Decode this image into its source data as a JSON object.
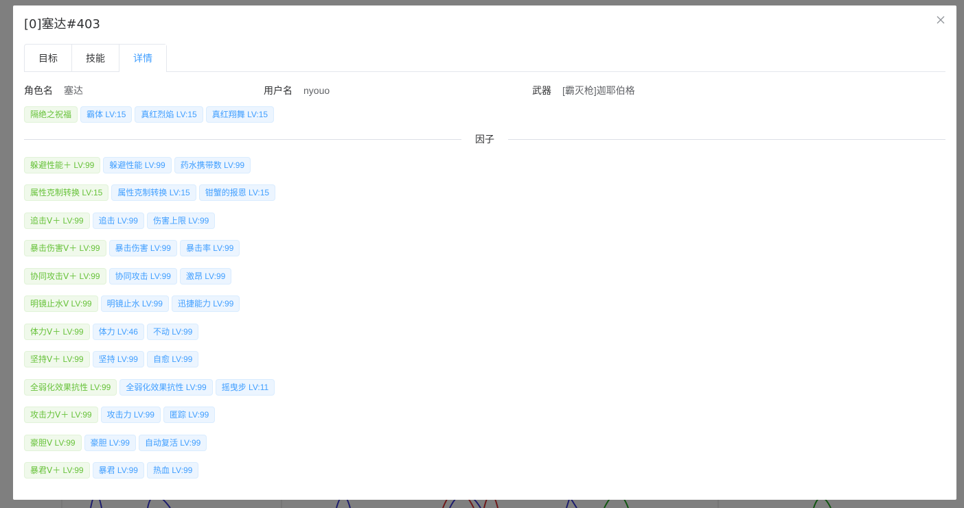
{
  "dialog": {
    "title": "[0]塞达#403",
    "close_icon": "close-icon"
  },
  "tabs": [
    {
      "label": "目标",
      "active": false
    },
    {
      "label": "技能",
      "active": false
    },
    {
      "label": "详情",
      "active": true
    }
  ],
  "info": {
    "role_label": "角色名",
    "role_value": "塞达",
    "user_label": "用户名",
    "user_value": "nyouo",
    "weapon_label": "武器",
    "weapon_value": "[霸灭枪]迦耶伯格"
  },
  "skills": [
    {
      "text": "隔绝之祝福",
      "color": "green"
    },
    {
      "text": "霸体 LV:15",
      "color": "blue"
    },
    {
      "text": "真红烈焰 LV:15",
      "color": "blue"
    },
    {
      "text": "真红翔舞 LV:15",
      "color": "blue"
    }
  ],
  "factor_title": "因子",
  "factors": [
    [
      {
        "text": "躲避性能＋ LV:99",
        "color": "green"
      },
      {
        "text": "躲避性能 LV:99",
        "color": "blue"
      },
      {
        "text": "药水携带数 LV:99",
        "color": "blue"
      }
    ],
    [
      {
        "text": "属性克制转换 LV:15",
        "color": "green"
      },
      {
        "text": "属性克制转换 LV:15",
        "color": "blue"
      },
      {
        "text": "钳蟹的报恩 LV:15",
        "color": "blue"
      }
    ],
    [
      {
        "text": "追击Ⅴ＋ LV:99",
        "color": "green"
      },
      {
        "text": "追击 LV:99",
        "color": "blue"
      },
      {
        "text": "伤害上限 LV:99",
        "color": "blue"
      }
    ],
    [
      {
        "text": "暴击伤害Ⅴ＋ LV:99",
        "color": "green"
      },
      {
        "text": "暴击伤害 LV:99",
        "color": "blue"
      },
      {
        "text": "暴击率 LV:99",
        "color": "blue"
      }
    ],
    [
      {
        "text": "协同攻击Ⅴ＋ LV:99",
        "color": "green"
      },
      {
        "text": "协同攻击 LV:99",
        "color": "blue"
      },
      {
        "text": "激昂 LV:99",
        "color": "blue"
      }
    ],
    [
      {
        "text": "明镜止水Ⅴ LV:99",
        "color": "green"
      },
      {
        "text": "明镜止水 LV:99",
        "color": "blue"
      },
      {
        "text": "迅捷能力 LV:99",
        "color": "blue"
      }
    ],
    [
      {
        "text": "体力Ⅴ＋ LV:99",
        "color": "green"
      },
      {
        "text": "体力 LV:46",
        "color": "blue"
      },
      {
        "text": "不动 LV:99",
        "color": "blue"
      }
    ],
    [
      {
        "text": "坚持Ⅴ＋ LV:99",
        "color": "green"
      },
      {
        "text": "坚持 LV:99",
        "color": "blue"
      },
      {
        "text": "自愈 LV:99",
        "color": "blue"
      }
    ],
    [
      {
        "text": "全弱化效果抗性 LV:99",
        "color": "green"
      },
      {
        "text": "全弱化效果抗性 LV:99",
        "color": "blue"
      },
      {
        "text": "摇曳步 LV:11",
        "color": "blue"
      }
    ],
    [
      {
        "text": "攻击力Ⅴ＋ LV:99",
        "color": "green"
      },
      {
        "text": "攻击力 LV:99",
        "color": "blue"
      },
      {
        "text": "匿踪 LV:99",
        "color": "blue"
      }
    ],
    [
      {
        "text": "豪胆Ⅴ LV:99",
        "color": "green"
      },
      {
        "text": "豪胆 LV:99",
        "color": "blue"
      },
      {
        "text": "自动复活 LV:99",
        "color": "blue"
      }
    ],
    [
      {
        "text": "暴君Ⅴ＋ LV:99",
        "color": "green"
      },
      {
        "text": "暴君 LV:99",
        "color": "blue"
      },
      {
        "text": "热血 LV:99",
        "color": "blue"
      }
    ]
  ]
}
